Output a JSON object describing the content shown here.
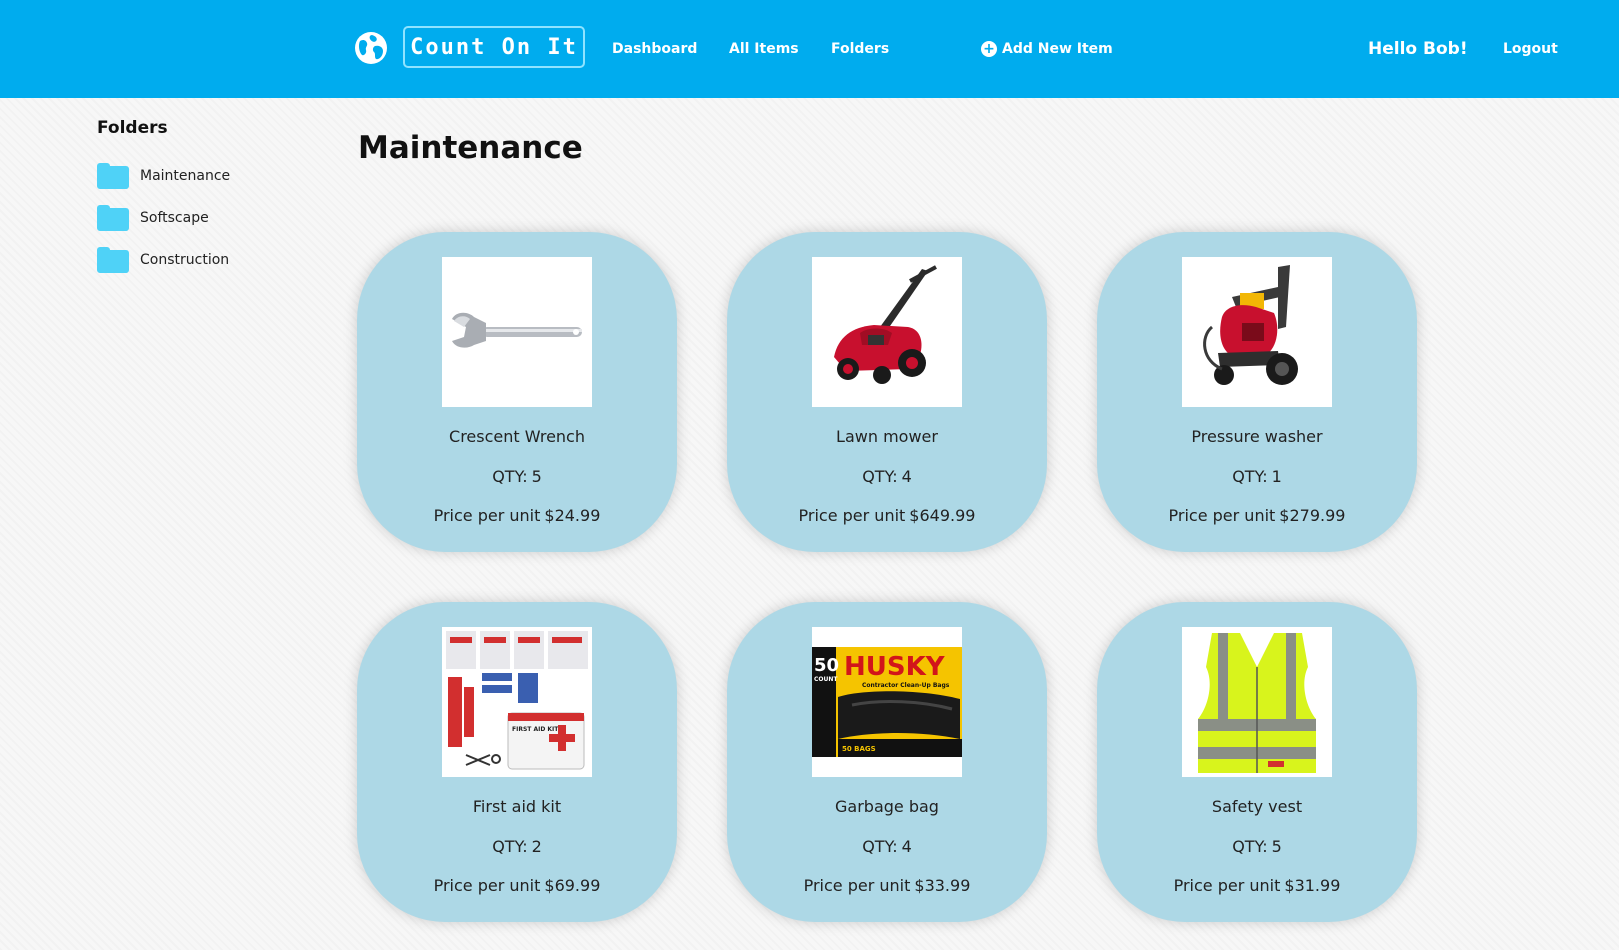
{
  "navbar": {
    "brand": "Count On It",
    "links": {
      "dashboard": "Dashboard",
      "all_items": "All Items",
      "folders": "Folders",
      "add_new_item": "Add New Item"
    },
    "greeting": "Hello Bob!",
    "logout": "Logout",
    "colors": {
      "background": "#00acee",
      "text": "#ffffff"
    }
  },
  "sidebar": {
    "title": "Folders",
    "folders": [
      {
        "label": "Maintenance"
      },
      {
        "label": "Softscape"
      },
      {
        "label": "Construction"
      }
    ],
    "folder_icon_color": "#4fd2f7"
  },
  "main": {
    "title": "Maintenance",
    "qty_label": "QTY:",
    "price_label": "Price per unit",
    "card_color": "#add8e6",
    "items": [
      {
        "name": "Crescent Wrench",
        "qty": "5",
        "price": "$24.99",
        "image": "wrench-image"
      },
      {
        "name": "Lawn mower",
        "qty": "4",
        "price": "$649.99",
        "image": "lawn-mower-image"
      },
      {
        "name": "Pressure washer",
        "qty": "1",
        "price": "$279.99",
        "image": "pressure-washer-image"
      },
      {
        "name": "First aid kit",
        "qty": "2",
        "price": "$69.99",
        "image": "first-aid-kit-image"
      },
      {
        "name": "Garbage bag",
        "qty": "4",
        "price": "$33.99",
        "image": "garbage-bag-image"
      },
      {
        "name": "Safety vest",
        "qty": "5",
        "price": "$31.99",
        "image": "safety-vest-image"
      }
    ],
    "image_text": {
      "husky_count": "50",
      "husky_count_word": "COUNT",
      "husky_brand": "HUSKY",
      "husky_sub": "Contractor Clean-Up Bags",
      "husky_bags": "50 BAGS",
      "first_aid_label": "FIRST AID KIT"
    }
  }
}
